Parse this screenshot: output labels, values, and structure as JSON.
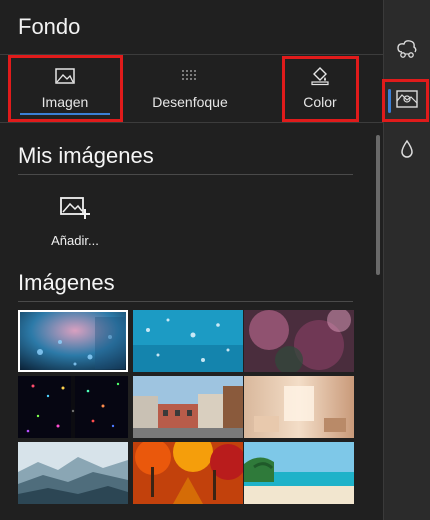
{
  "panel": {
    "title": "Fondo"
  },
  "tabs": [
    {
      "label": "Imagen",
      "icon": "image-icon",
      "active": true
    },
    {
      "label": "Desenfoque",
      "icon": "blur-dots-icon",
      "active": false
    },
    {
      "label": "Color",
      "icon": "paint-bucket-icon",
      "active": false
    }
  ],
  "my_images": {
    "title": "Mis imágenes",
    "add_label": "Añadir..."
  },
  "images": {
    "title": "Imágenes",
    "thumbnails": [
      {
        "name": "rain-glass-bokeh",
        "selected": true
      },
      {
        "name": "blue-water-drops"
      },
      {
        "name": "pink-bokeh"
      },
      {
        "name": "colorful-dots-tunnel"
      },
      {
        "name": "european-street"
      },
      {
        "name": "warm-interior"
      },
      {
        "name": "misty-mountains"
      },
      {
        "name": "autumn-forest"
      },
      {
        "name": "tropical-beach"
      }
    ]
  },
  "rail": {
    "items": [
      {
        "icon": "cutout-icon"
      },
      {
        "icon": "background-image-icon",
        "active": true
      },
      {
        "icon": "drop-icon"
      }
    ]
  },
  "colors": {
    "accent": "#3b7fd6",
    "highlight": "#e01b1b",
    "background": "#202020"
  }
}
